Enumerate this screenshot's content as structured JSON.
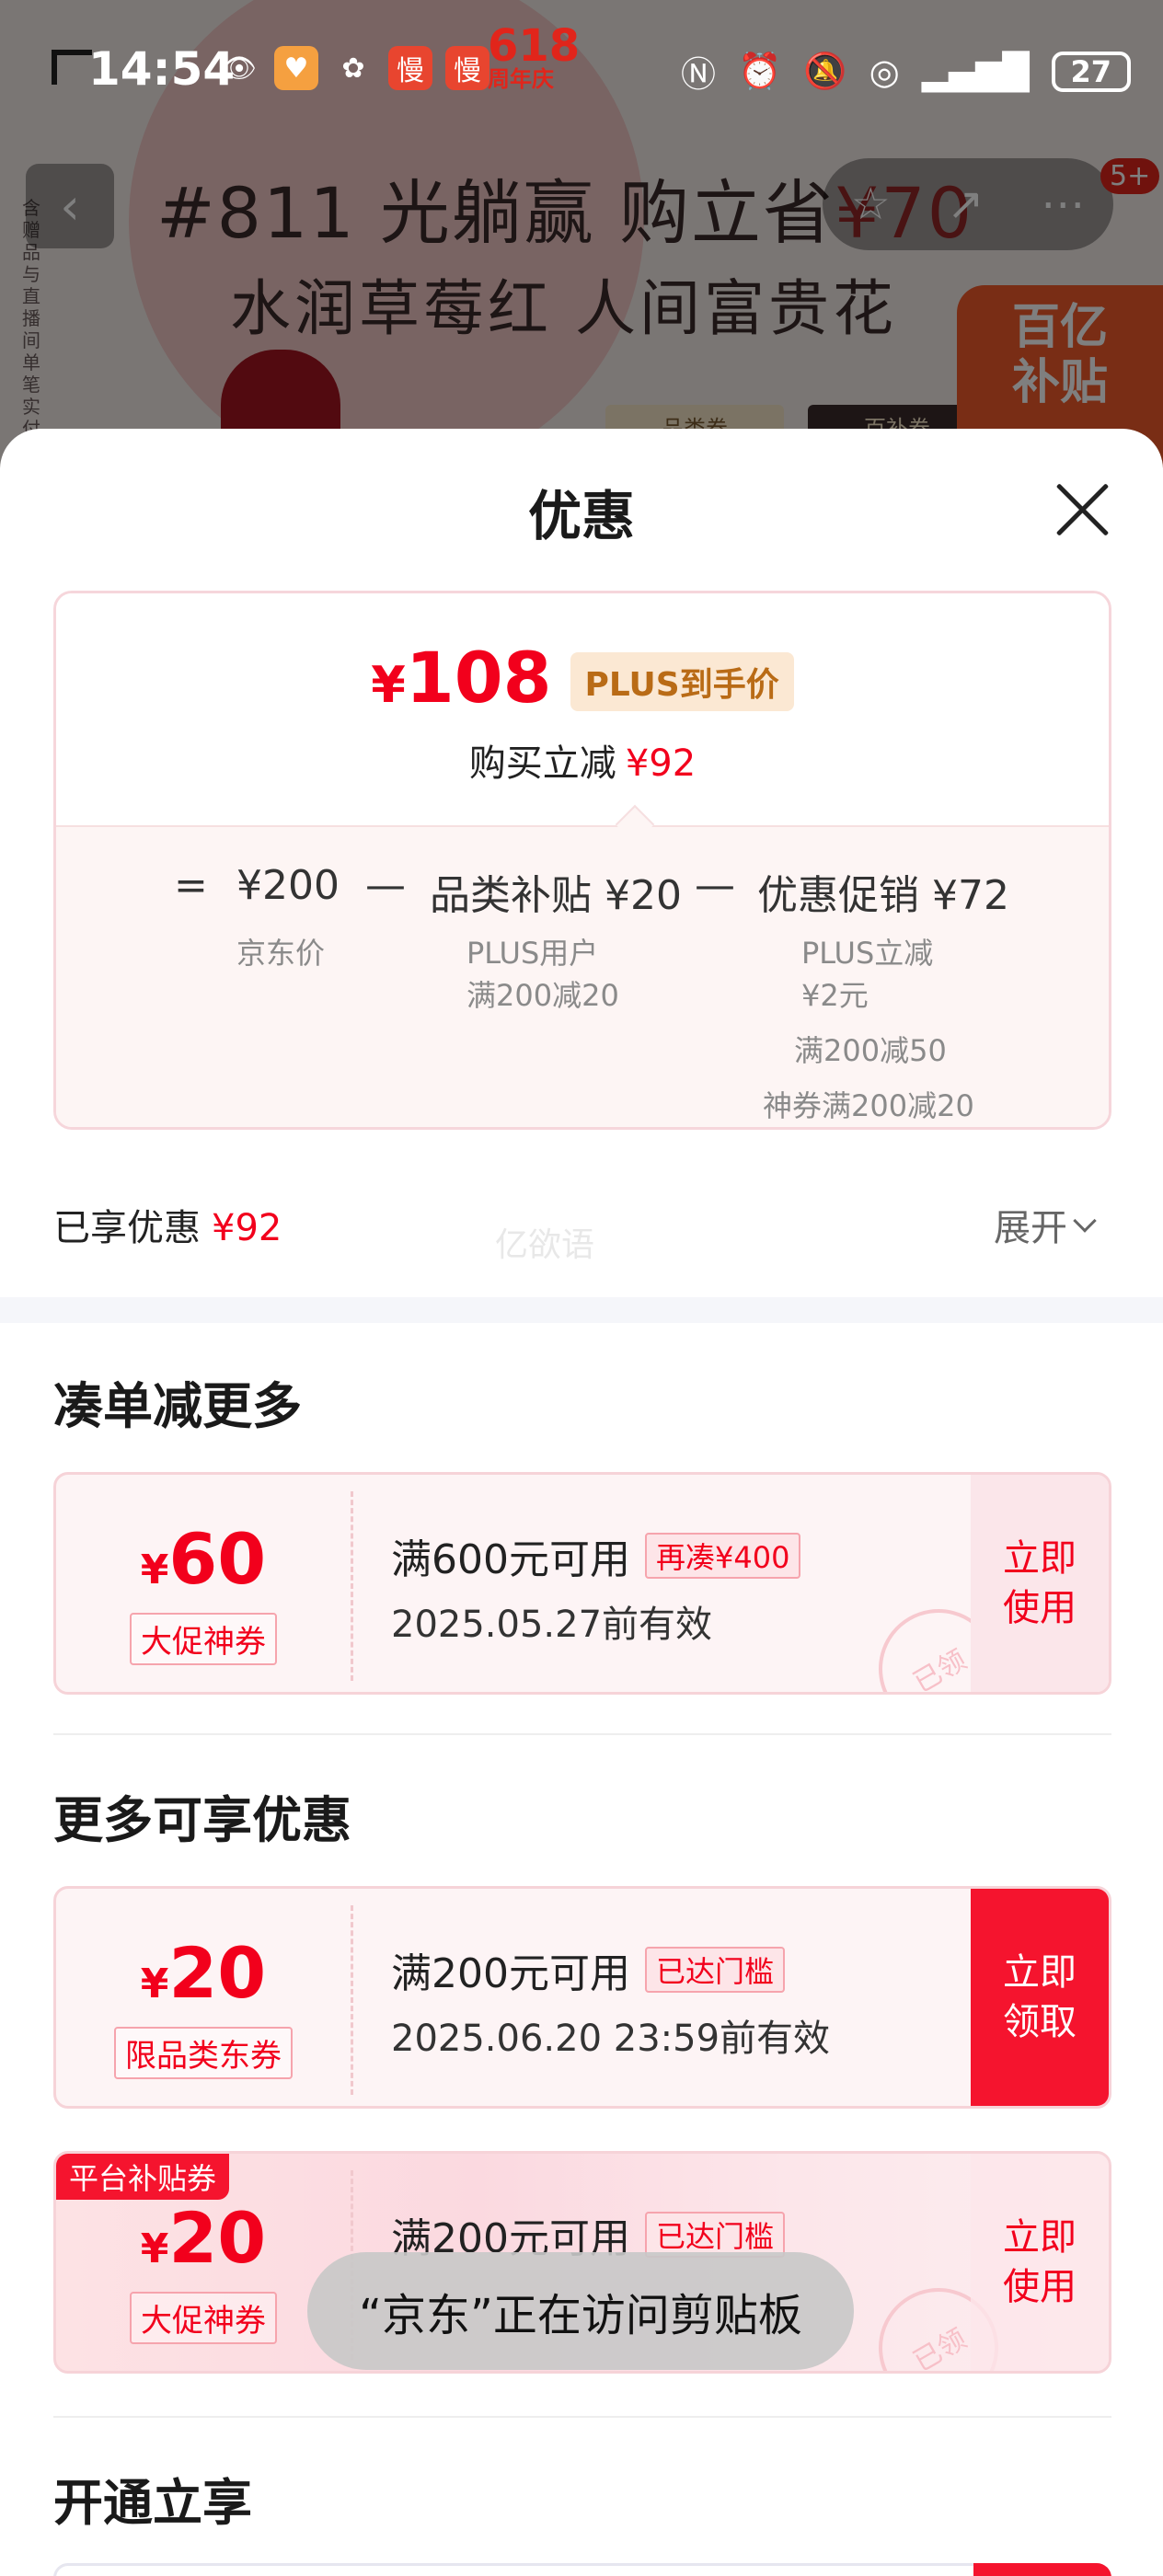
{
  "status_bar": {
    "time": "14:54",
    "badge_618": "618",
    "badge_618_sub": "周年庆",
    "battery": "27"
  },
  "background_page": {
    "banner_line1": "#811 光躺赢  购立省",
    "banner_amount": "¥70",
    "banner_line2": "水润草莓红  人间富贵花",
    "subsidy_line1": "百亿",
    "subsidy_line2": "补贴",
    "tag1": "—品类券—",
    "tag2": "—百补券—",
    "notification_count": "5+",
    "side_text": "含赠品与直播间单笔实付"
  },
  "sheet": {
    "title": "优惠",
    "final_price_symbol": "¥",
    "final_price": "108",
    "plus_tag": "PLUS到手价",
    "instant_reduce_label": "购买立减",
    "instant_reduce_value": "¥92",
    "breakdown": {
      "equals": "=",
      "jd_price": "¥200",
      "minus1": "—",
      "category_subsidy": "品类补贴 ¥20",
      "minus2": "—",
      "promotion": "优惠促销 ¥72",
      "jd_price_label": "京东价",
      "category_note_1": "PLUS用户",
      "category_note_2": "满200减20",
      "promo_note_1": "PLUS立减",
      "promo_note_2": "¥2元",
      "promo_note_3": "满200减50",
      "promo_note_4": "神券满200减20"
    },
    "enjoyed_label": "已享优惠",
    "enjoyed_value": "¥92",
    "expand_label": "展开",
    "watermark": "亿欲语"
  },
  "sections": {
    "combine_title": "凑单减更多",
    "more_title": "更多可享优惠",
    "open_title": "开通立享"
  },
  "coupons": [
    {
      "symbol": "¥",
      "amount": "60",
      "type": "大促神券",
      "condition": "满600元可用",
      "tag": "再凑¥400",
      "date": "2025.05.27前有效",
      "button": "立即\n使用",
      "stamp": "已领"
    },
    {
      "symbol": "¥",
      "amount": "20",
      "type": "限品类东券",
      "condition": "满200元可用",
      "tag": "已达门槛",
      "date": "2025.06.20 23:59前有效",
      "button": "立即\n领取"
    },
    {
      "corner": "平台补贴券",
      "symbol": "¥",
      "amount": "20",
      "type": "大促神券",
      "condition": "满200元可用",
      "tag": "已达门槛",
      "button": "立即\n使用",
      "stamp": "已领"
    }
  ],
  "toast": "“京东”正在访问剪贴板"
}
